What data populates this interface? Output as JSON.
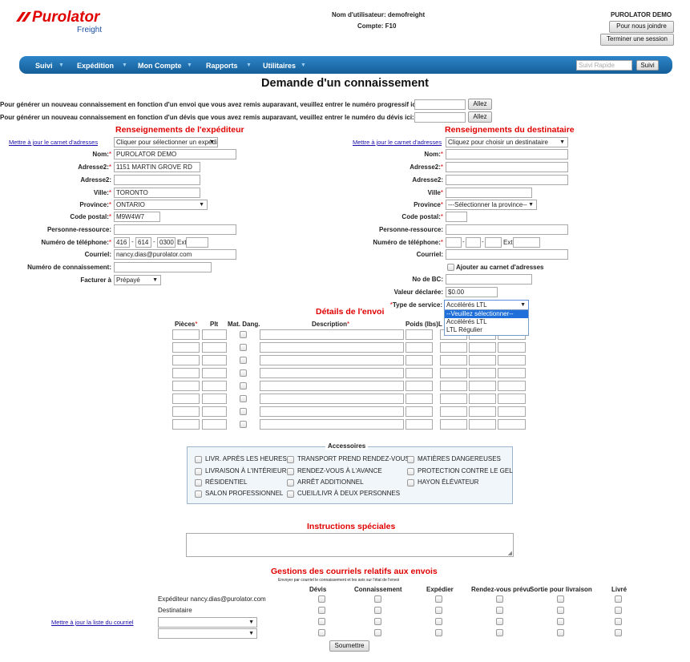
{
  "header": {
    "logo": "Purolator",
    "logo_sub": "Freight",
    "user_label": "Nom d'utilisateur: demofreight",
    "account_label": "Compte: F10",
    "company": "PUROLATOR DEMO",
    "contact_btn": "Pour nous joindre",
    "logout_btn": "Terminer une session"
  },
  "nav": {
    "items": [
      "Suivi",
      "Expédition",
      "Mon Compte",
      "Rapports",
      "Utilitaires"
    ],
    "quick_placeholder": "Suivi Rapide",
    "quick_btn": "Suivi"
  },
  "page_title": "Demande d'un connaissement",
  "intro": {
    "line1": "Pour générer un nouveau connaissement en fonction d'un envoi que vous avez remis auparavant, veuillez entrer le numéro progressif ici:",
    "line2": "Pour générer un nouveau connaissement en fonction d'un dévis que vous avez remis auparavant, veuillez entrer le numéro du dévis ici:",
    "go": "Allez"
  },
  "shipper": {
    "title": "Renseignements de l'expéditeur",
    "addr_link": "Mettre à jour le carnet d'adresses",
    "addr_select": "Cliquer pour sélectionner un expéditeur",
    "name_label": "Nom:",
    "name": "PUROLATOR DEMO",
    "addr2_label": "Adresse2:",
    "addr1_value": "1151 MARTIN GROVE RD",
    "addr2b_label": "Adresse2:",
    "city_label": "Ville:",
    "city": "TORONTO",
    "prov_label": "Province:",
    "province": "ONTARIO",
    "postal_label": "Code postal:",
    "postal": "M9W4W7",
    "contact_label": "Personne-ressource:",
    "phone_label": "Numéro de téléphone:",
    "phone1": "416",
    "phone2": "614",
    "phone3": "0300",
    "ext": "Ext",
    "email_label": "Courriel:",
    "email": "nancy.dias@purolator.com",
    "bol_label": "Numéro de connaissement:",
    "bill_label": "Facturer à",
    "bill": "Prépayé"
  },
  "consignee": {
    "title": "Renseignements du destinataire",
    "addr_link": "Mettre à jour le carnet d'adresses",
    "addr_select": "Cliquez pour choisir un destinataire",
    "name_label": "Nom:",
    "addr2_label": "Adresse2:",
    "addr2b_label": "Adresse2:",
    "city_label": "Ville",
    "prov_label": "Province",
    "province": "---Sélectionner la province--",
    "postal_label": "Code postal:",
    "contact_label": "Personne-ressource:",
    "phone_label": "Numéro de téléphone:",
    "ext": "Ext",
    "email_label": "Courriel:",
    "add_book": "Ajouter au carnet d'adresses",
    "po_label": "No de BC:",
    "declared_label": "Valeur déclarée:",
    "declared": "$0.00",
    "service_label": "Type de service:",
    "service": "Accélérés LTL",
    "service_options": [
      "--Veuillez sélectionner--",
      "Accélérés LTL",
      "LTL Régulier"
    ]
  },
  "details": {
    "title": "Détails de l'envoi",
    "cols": [
      "Pièces",
      "Plt",
      "Mat. Dang.",
      "Description",
      "Poids (lbs)",
      "L"
    ]
  },
  "accessories": {
    "legend": "Accessoires",
    "items": [
      "LIVR. APRÈS LES HEURES",
      "TRANSPORT PREND RENDEZ-VOUS",
      "MATIÈRES DANGEREUSES",
      "LIVRAISON À L'INTÉRIEUR",
      "RENDEZ-VOUS À L'AVANCE",
      "PROTECTION CONTRE LE GEL",
      "RÉSIDENTIEL",
      "ARRÊT ADDITIONNEL",
      "HAYON ÉLÉVATEUR",
      "SALON PROFESSIONNEL",
      "CUEIL/LIVR À DEUX PERSONNES"
    ]
  },
  "instructions": {
    "title": "Instructions spéciales"
  },
  "email_mgmt": {
    "title": "Gestions des courriels relatifs aux envois",
    "subtitle": "Envoyer par courriel le connaissement et les avis sur l'état de l'envoi",
    "cols": [
      "Dévis",
      "Connaissement",
      "Expédier",
      "Rendez-vous prévu",
      "Sortie pour livraison",
      "Livré"
    ],
    "row1": "Expéditeur nancy.dias@purolator.com",
    "row2": "Destinataire",
    "list_link": "Mettre à jour la liste du courriel",
    "submit": "Soumettre"
  },
  "colors": {
    "nav_bg": "#1a6aa8",
    "red": "#e00000",
    "link": "#1a0dab",
    "logo_blue": "#1b4fa0"
  }
}
